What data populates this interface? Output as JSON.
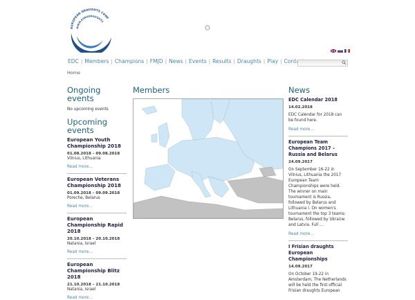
{
  "logo": {
    "text_top": "EUROPEAN DRAUGHTS CONFEDERATION",
    "text_bottom": "WWW.EURODRAUGHTS.COM"
  },
  "colors": {
    "accent": "#22607f",
    "link": "#4a86aa",
    "map_member": "#cfe6f7",
    "map_land": "#c2c2c2"
  },
  "nav": {
    "items": [
      "EDC",
      "Members",
      "Champions",
      "FMJD",
      "News",
      "Events",
      "Results",
      "Draughts",
      "Play",
      "Contact"
    ]
  },
  "search": {
    "placeholder": ""
  },
  "breadcrumb": "Home",
  "left": {
    "ongoing_title": "Ongoing events",
    "ongoing_text": "No upcoming events",
    "upcoming_title": "Upcoming events",
    "events": [
      {
        "title": "European Youth Championship 2018",
        "dates": "01.08.2018 – 09.08.2018",
        "place": "Vilnius, Lithuania",
        "more": "Read more..."
      },
      {
        "title": "European Veterans Championship 2018",
        "dates": "01.09.2018 – 09.09.2018",
        "place": "Poreche, Belarus",
        "more": "Read more..."
      },
      {
        "title": "European Championship Rapid 2018",
        "dates": "20.10.2018 – 20.10.2018",
        "place": "Natania, Israel",
        "more": "Read more..."
      },
      {
        "title": "European Championship Blitz 2018",
        "dates": "21.10.2018 – 21.10.2018",
        "place": "Natania, Israel",
        "more": "Read more..."
      }
    ]
  },
  "middle": {
    "title": "Members"
  },
  "right": {
    "title": "News",
    "news": [
      {
        "title": "EDC Calendar 2018",
        "date": "14.02.2018",
        "text": "EDC Calendar for 2018 can be found here.",
        "more": "Read more..."
      },
      {
        "title": "European Team Champions 2017 – Russia and Belarus",
        "date": "24.09.2017",
        "text": "On September 16-22 in Vilnius, Lithuania the 2017 European Team Championships were held. The winner on main tournament is Russia, followed by Belarus and Lithuania I. On women's tournament the top 3 teams: Belarus, followed by Ukraine and Latvia. Full ...",
        "more": "Read more..."
      },
      {
        "title": "I Frisian draughts European Championships",
        "date": "14.09.2017",
        "text": "On October 19-22 in Amsterdam, The Netherlands will be held the first official Frisian draughts European",
        "more": ""
      }
    ]
  }
}
